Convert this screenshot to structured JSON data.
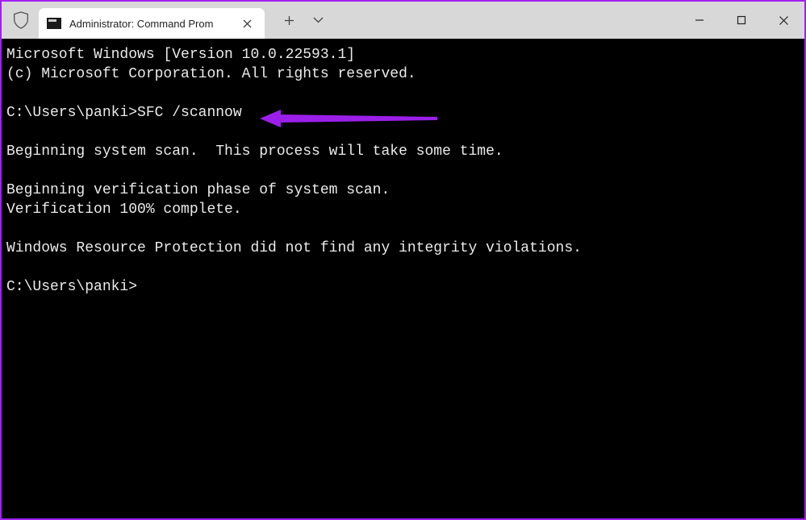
{
  "colors": {
    "accent_purple": "#9b1fe9",
    "terminal_bg": "#000000",
    "terminal_fg": "#eceaea",
    "titlebar_bg": "#d8d8d8",
    "tab_bg": "#ffffff"
  },
  "titlebar": {
    "tab_title": "Administrator: Command Prom",
    "icons": {
      "shield": "shield-icon",
      "cmd": "cmd-icon",
      "close_tab": "close-icon",
      "new_tab": "plus-icon",
      "tab_menu": "chevron-down-icon",
      "minimize": "minimize-icon",
      "maximize": "maximize-icon",
      "close_window": "close-icon"
    }
  },
  "terminal": {
    "lines": {
      "l0": "Microsoft Windows [Version 10.0.22593.1]",
      "l1": "(c) Microsoft Corporation. All rights reserved.",
      "l2_prompt": "C:\\Users\\panki>",
      "l2_cmd": "SFC /scannow",
      "l3": "Beginning system scan.  This process will take some time.",
      "l4": "Beginning verification phase of system scan.",
      "l5": "Verification 100% complete.",
      "l6": "Windows Resource Protection did not find any integrity violations.",
      "l7": "C:\\Users\\panki>"
    }
  }
}
